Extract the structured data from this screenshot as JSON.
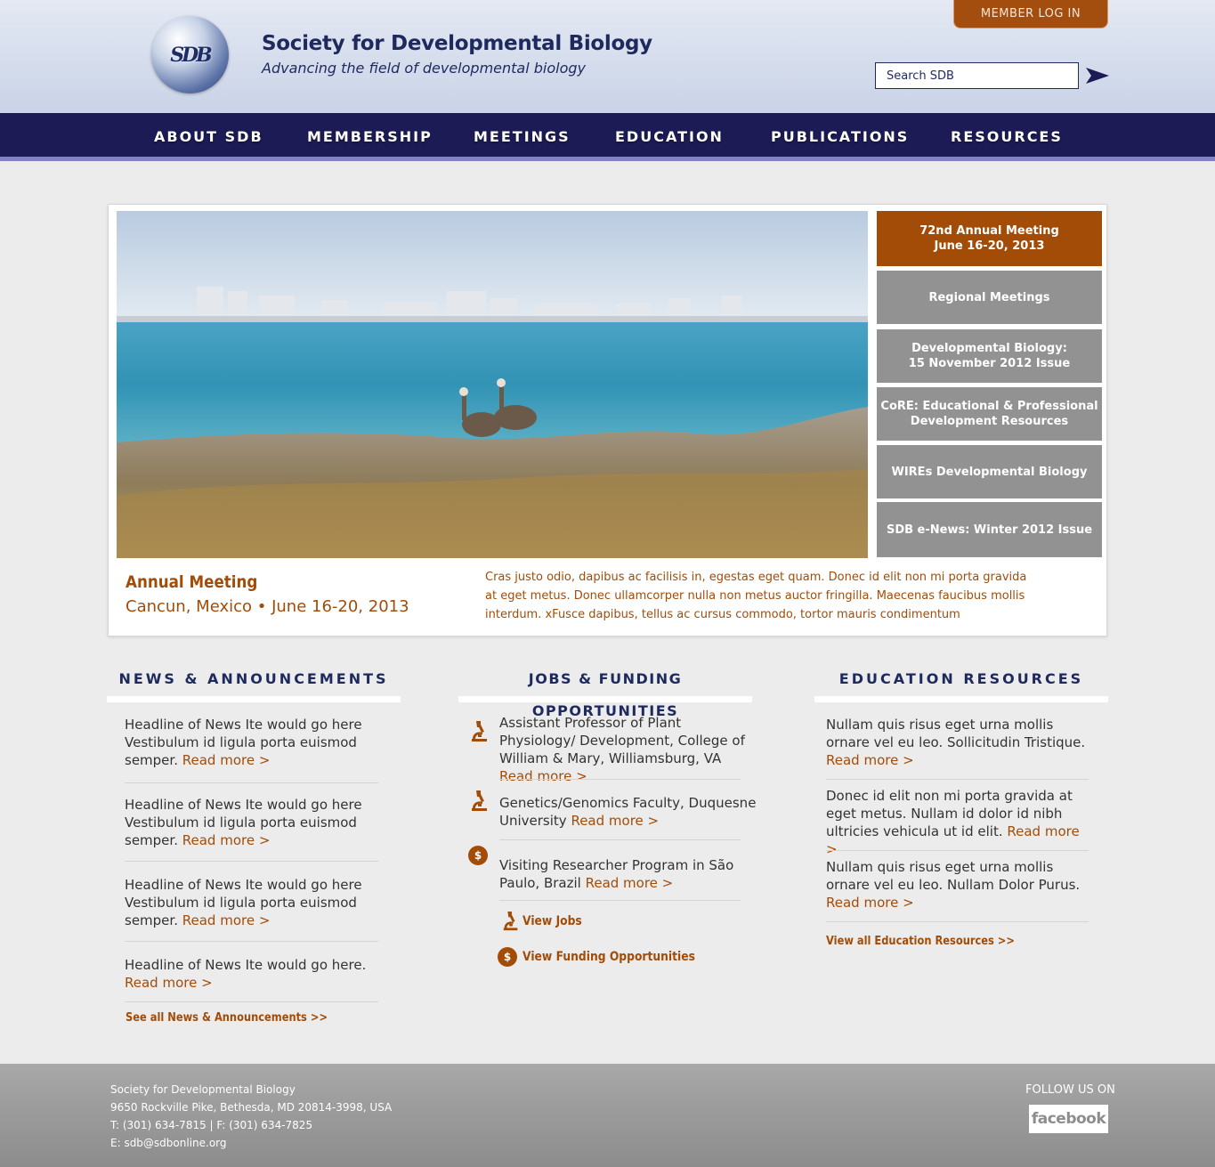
{
  "header": {
    "title": "Society for Developmental Biology",
    "tagline": "Advancing the field of developmental biology",
    "member_login": "MEMBER LOG IN",
    "search_placeholder": "Search SDB"
  },
  "nav": [
    "ABOUT SDB",
    "MEMBERSHIP",
    "MEETINGS",
    "EDUCATION",
    "PUBLICATIONS",
    "RESOURCES"
  ],
  "feature": {
    "side_buttons": [
      "72nd Annual Meeting\nJune 16-20, 2013",
      "Regional Meetings",
      "Developmental Biology:\n15 November 2012 Issue",
      "CoRE: Educational & Professional\nDevelopment Resources",
      "WIREs Developmental Biology",
      "SDB e-News: Winter 2012 Issue"
    ],
    "caption_title": "Annual Meeting",
    "caption_sub": "Cancun, Mexico  •  June 16-20, 2013",
    "caption_text": "Cras justo odio, dapibus ac facilisis in, egestas eget quam. Donec id elit non mi porta gravida at eget metus. Donec ullamcorper nulla non metus auctor fringilla. Maecenas faucibus mollis interdum. xFusce dapibus, tellus ac cursus commodo, tortor mauris condimentum"
  },
  "news": {
    "heading": "NEWS & ANNOUNCEMENTS",
    "items": [
      "Headline of News Ite would go here Vestibulum id ligula porta euismod semper.",
      "Headline of News Ite would go here Vestibulum id ligula porta euismod semper.",
      "Headline of News Ite would go here Vestibulum id ligula porta euismod semper.",
      "Headline of News Ite would go here."
    ],
    "read_more": "Read more >",
    "see_all": "See all News & Announcements >>"
  },
  "jobs": {
    "heading": "JOBS & FUNDING OPPORTUNITIES",
    "items": [
      {
        "text": "Assistant Professor of Plant Physiology/ Development, College of William & Mary, Williamsburg, VA",
        "icon": "microscope-icon"
      },
      {
        "text": "Genetics/Genomics Faculty, Duquesne University",
        "icon": "microscope-icon"
      },
      {
        "text": "Visiting Researcher Program in São Paulo, Brazil",
        "icon": "dollar-icon"
      }
    ],
    "read_more": "Read more >",
    "view_jobs": "View Jobs",
    "view_funding": "View Funding Opportunities"
  },
  "education": {
    "heading": "EDUCATION RESOURCES",
    "items": [
      "Nullam quis risus eget urna mollis ornare vel eu leo. Sollicitudin Tristique.",
      "Donec id elit non mi porta gravida at eget metus. Nullam id dolor id nibh ultricies vehicula ut id elit.",
      "Nullam quis risus eget urna mollis ornare vel eu leo.  Nullam Dolor Purus."
    ],
    "read_more": "Read more >",
    "view_all": "View all Education Resources >>"
  },
  "footer": {
    "org": "Society for Developmental Biology",
    "address": "9650 Rockville Pike, Bethesda, MD  20814-3998, USA",
    "phone": "T: (301) 634-7815  |  F: (301) 634-7825",
    "email": "E: sdb@sdbonline.org",
    "follow": "FOLLOW US ON",
    "facebook": "facebook"
  },
  "colors": {
    "navy": "#1c1b55",
    "accent_orange": "#a34c08",
    "side_button_gray": "#929292"
  }
}
